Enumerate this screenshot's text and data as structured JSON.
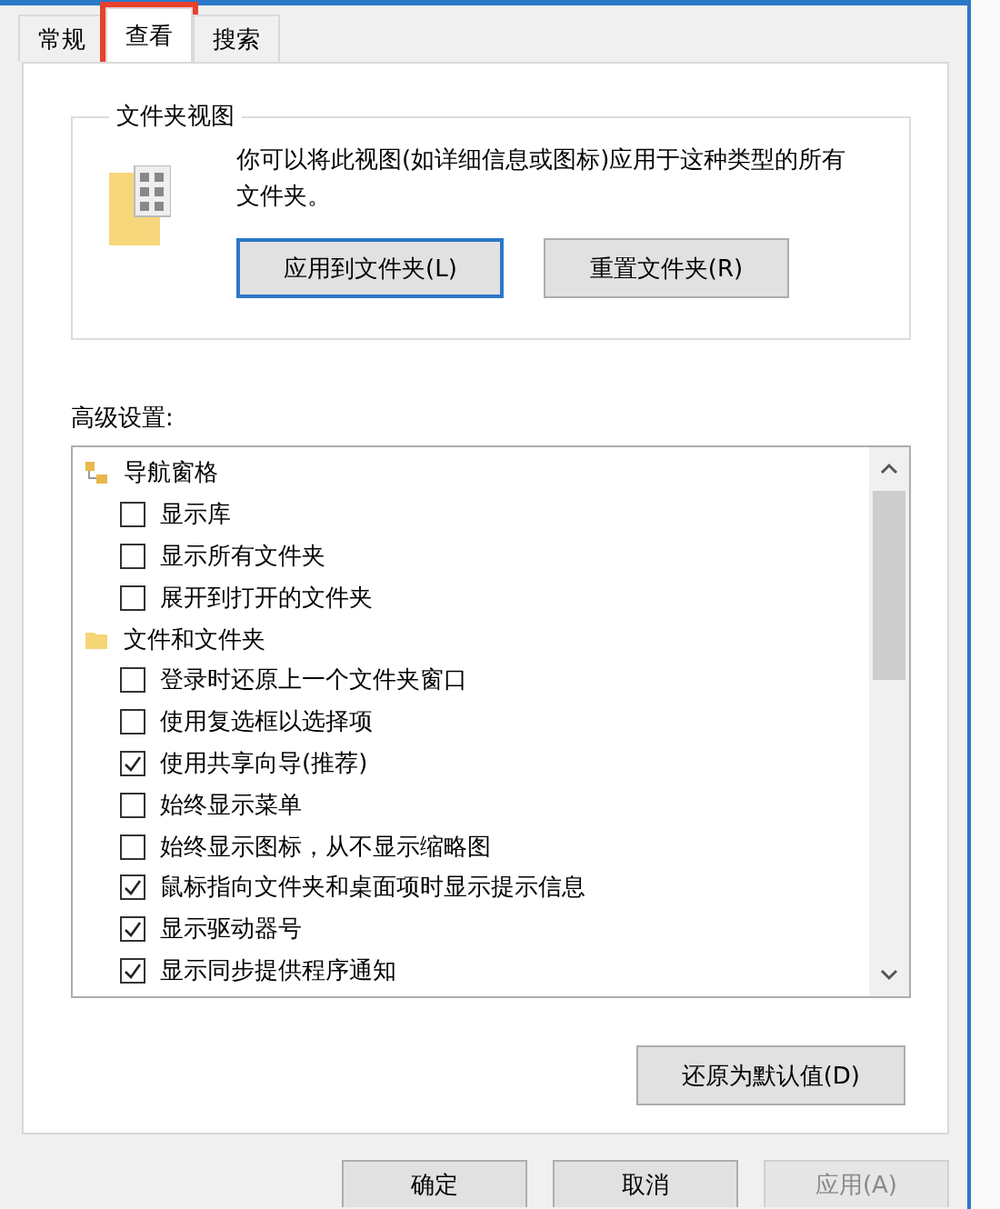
{
  "tabs": [
    {
      "label": "常规",
      "selected": false,
      "highlighted": false
    },
    {
      "label": "查看",
      "selected": true,
      "highlighted": true
    },
    {
      "label": "搜索",
      "selected": false,
      "highlighted": false
    }
  ],
  "folder_view": {
    "title": "文件夹视图",
    "description": "你可以将此视图(如详细信息或图标)应用于这种类型的所有文件夹。",
    "buttons": [
      {
        "label": "应用到文件夹(L)",
        "default": true
      },
      {
        "label": "重置文件夹(R)",
        "default": false
      }
    ]
  },
  "advanced": {
    "label": "高级设置:",
    "items": [
      {
        "kind": "tree",
        "label": "导航窗格"
      },
      {
        "kind": "checkbox",
        "label": "显示库",
        "checked": false
      },
      {
        "kind": "checkbox",
        "label": "显示所有文件夹",
        "checked": false
      },
      {
        "kind": "checkbox",
        "label": "展开到打开的文件夹",
        "checked": false
      },
      {
        "kind": "folder",
        "label": "文件和文件夹"
      },
      {
        "kind": "checkbox",
        "label": "登录时还原上一个文件夹窗口",
        "checked": false
      },
      {
        "kind": "checkbox",
        "label": "使用复选框以选择项",
        "checked": false
      },
      {
        "kind": "checkbox",
        "label": "使用共享向导(推荐)",
        "checked": true
      },
      {
        "kind": "checkbox",
        "label": "始终显示菜单",
        "checked": false
      },
      {
        "kind": "checkbox",
        "label": "始终显示图标，从不显示缩略图",
        "checked": false
      },
      {
        "kind": "checkbox",
        "label": "鼠标指向文件夹和桌面项时显示提示信息",
        "checked": true
      },
      {
        "kind": "checkbox",
        "label": "显示驱动器号",
        "checked": true
      },
      {
        "kind": "checkbox",
        "label": "显示同步提供程序通知",
        "checked": true
      }
    ],
    "restore_button": "还原为默认值(D)"
  },
  "buttons": [
    {
      "label": "确定",
      "disabled": false
    },
    {
      "label": "取消",
      "disabled": false
    },
    {
      "label": "应用(A)",
      "disabled": true
    }
  ]
}
